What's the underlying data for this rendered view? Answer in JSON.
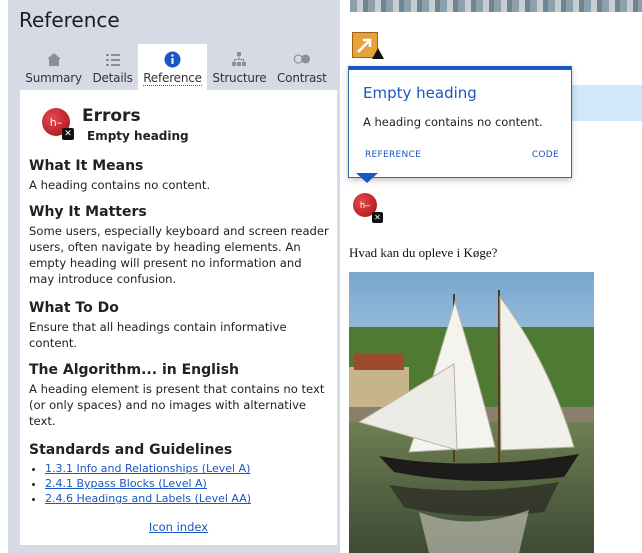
{
  "sidebar": {
    "title": "Reference",
    "tabs": [
      {
        "label": "Summary",
        "icon": "home-icon"
      },
      {
        "label": "Details",
        "icon": "list-icon"
      },
      {
        "label": "Reference",
        "icon": "info-icon"
      },
      {
        "label": "Structure",
        "icon": "structure-icon"
      },
      {
        "label": "Contrast",
        "icon": "contrast-icon"
      }
    ],
    "active_tab": "Reference"
  },
  "panel": {
    "error_title": "Errors",
    "error_subtitle": "Empty heading",
    "error_icon_text": "h–",
    "sections": [
      {
        "heading": "What It Means",
        "text": "A heading contains no content."
      },
      {
        "heading": "Why It Matters",
        "text": "Some users, especially keyboard and screen reader users, often navigate by heading elements. An empty heading will present no information and may introduce confusion."
      },
      {
        "heading": "What To Do",
        "text": "Ensure that all headings contain informative content."
      },
      {
        "heading": "The Algorithm... in English",
        "text": "A heading element is present that contains no text (or only spaces) and no images with alternative text."
      }
    ],
    "standards_heading": "Standards and Guidelines",
    "standards": [
      "1.3.1 Info and Relationships (Level A)",
      "2.4.1 Bypass Blocks (Level A)",
      "2.4.6 Headings and Labels (Level AA)"
    ],
    "icon_index_label": "Icon index"
  },
  "popup": {
    "title": "Empty heading",
    "description": "A heading contains no content.",
    "reference_link": "REFERENCE",
    "code_link": "CODE"
  },
  "page": {
    "heading_icon_text": "h–",
    "heading": "Hvad kan du opleve i Køge?"
  },
  "colors": {
    "accent": "#1a56c4",
    "error_red": "#c1272d",
    "sidebar_bg": "#d6dae4",
    "alert_orange": "#e8a23a"
  }
}
